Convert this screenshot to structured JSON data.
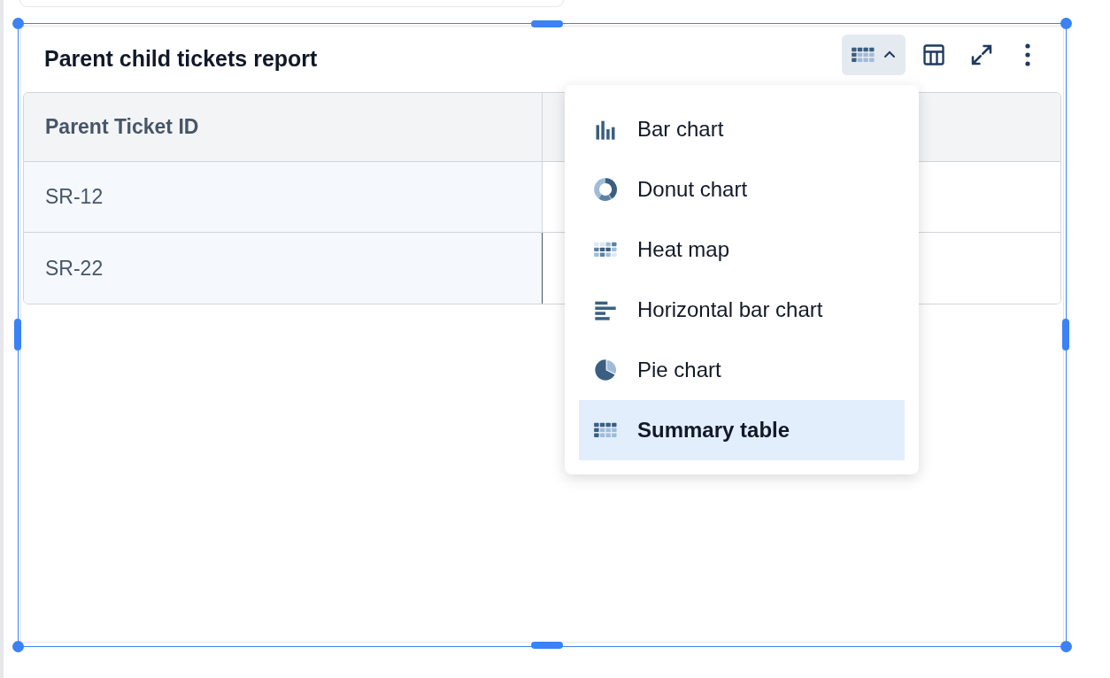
{
  "report": {
    "title": "Parent child tickets report"
  },
  "toolbar": {
    "chart_type_menu_expanded": true
  },
  "table": {
    "columns": [
      "Parent Ticket ID"
    ],
    "rows": [
      [
        "SR-12"
      ],
      [
        "SR-22"
      ]
    ]
  },
  "chart_type_menu": [
    {
      "label": "Bar chart",
      "kind": "bar",
      "selected": false
    },
    {
      "label": "Donut chart",
      "kind": "donut",
      "selected": false
    },
    {
      "label": "Heat map",
      "kind": "heatmap",
      "selected": false
    },
    {
      "label": "Horizontal bar chart",
      "kind": "hbar",
      "selected": false
    },
    {
      "label": "Pie chart",
      "kind": "pie",
      "selected": false
    },
    {
      "label": "Summary table",
      "kind": "table",
      "selected": true
    }
  ]
}
